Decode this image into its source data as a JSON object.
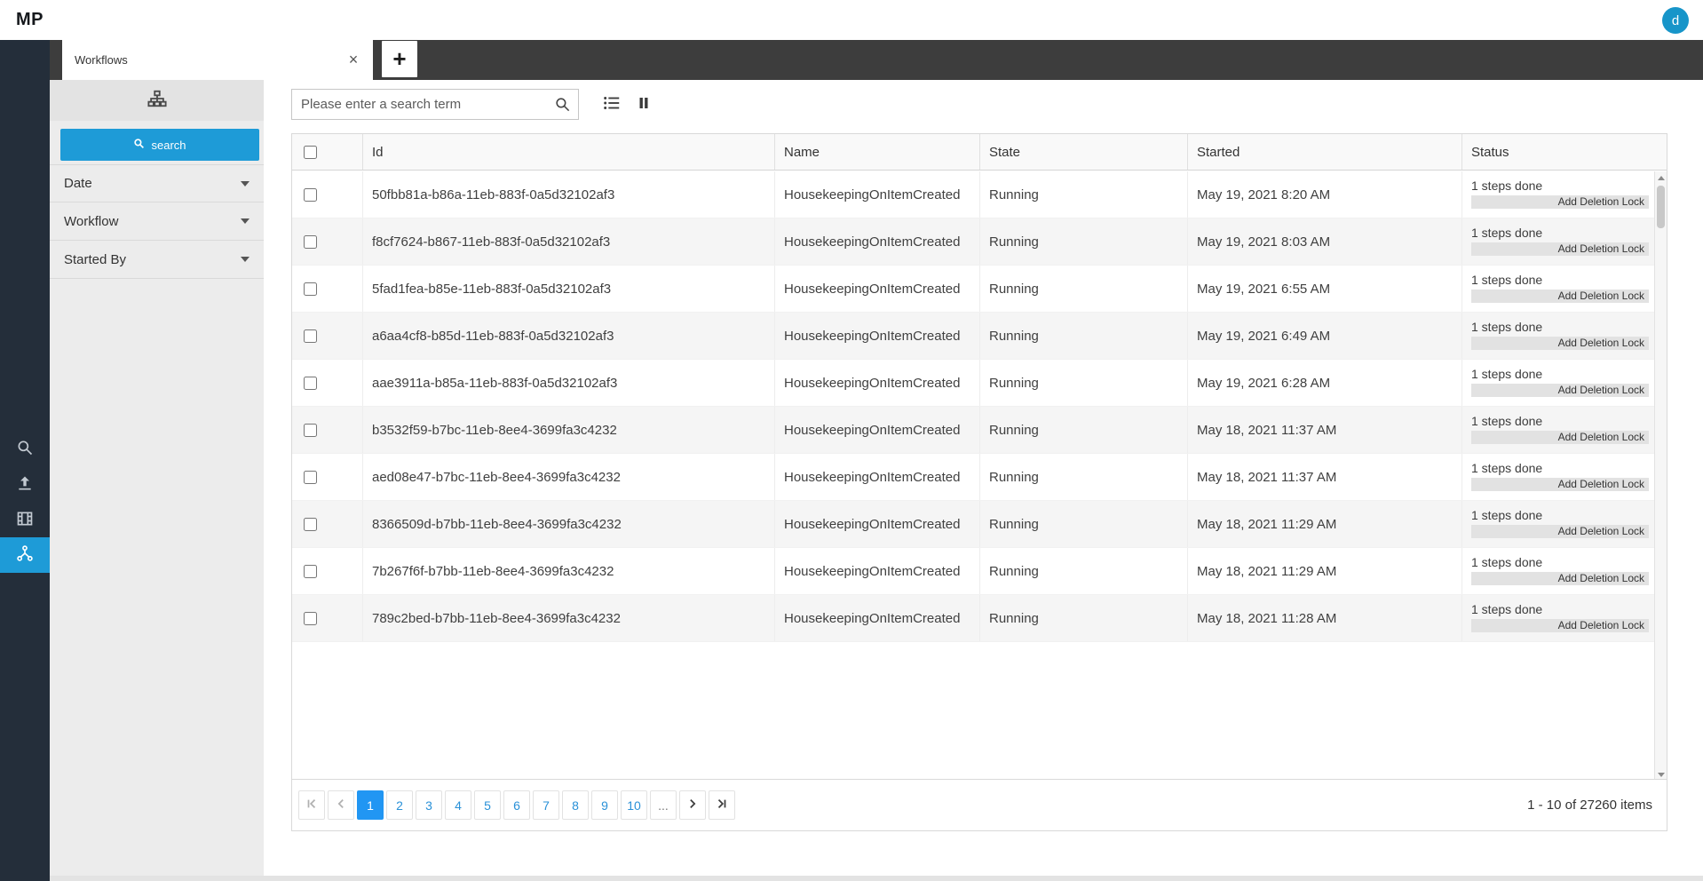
{
  "header": {
    "logo": "MP",
    "avatar_initial": "d"
  },
  "tab_bar": {
    "active_tab": "Workflows",
    "close_glyph": "×",
    "add_glyph": "+"
  },
  "rail": {
    "items": [
      "search",
      "upload",
      "media",
      "workflows"
    ],
    "active_item": "workflows"
  },
  "filter_panel": {
    "search_button_label": "search",
    "sections": [
      "Date",
      "Workflow",
      "Started By"
    ]
  },
  "toolbar": {
    "search_placeholder": "Please enter a search term"
  },
  "grid": {
    "columns": {
      "id": "Id",
      "name": "Name",
      "state": "State",
      "started": "Started",
      "status": "Status"
    },
    "rows": [
      {
        "id": "50fbb81a-b86a-11eb-883f-0a5d32102af3",
        "name": "HousekeepingOnItemCreated",
        "state": "Running",
        "started": "May 19, 2021 8:20 AM",
        "status_text": "1 steps done",
        "status_action": "Add Deletion Lock"
      },
      {
        "id": "f8cf7624-b867-11eb-883f-0a5d32102af3",
        "name": "HousekeepingOnItemCreated",
        "state": "Running",
        "started": "May 19, 2021 8:03 AM",
        "status_text": "1 steps done",
        "status_action": "Add Deletion Lock"
      },
      {
        "id": "5fad1fea-b85e-11eb-883f-0a5d32102af3",
        "name": "HousekeepingOnItemCreated",
        "state": "Running",
        "started": "May 19, 2021 6:55 AM",
        "status_text": "1 steps done",
        "status_action": "Add Deletion Lock"
      },
      {
        "id": "a6aa4cf8-b85d-11eb-883f-0a5d32102af3",
        "name": "HousekeepingOnItemCreated",
        "state": "Running",
        "started": "May 19, 2021 6:49 AM",
        "status_text": "1 steps done",
        "status_action": "Add Deletion Lock"
      },
      {
        "id": "aae3911a-b85a-11eb-883f-0a5d32102af3",
        "name": "HousekeepingOnItemCreated",
        "state": "Running",
        "started": "May 19, 2021 6:28 AM",
        "status_text": "1 steps done",
        "status_action": "Add Deletion Lock"
      },
      {
        "id": "b3532f59-b7bc-11eb-8ee4-3699fa3c4232",
        "name": "HousekeepingOnItemCreated",
        "state": "Running",
        "started": "May 18, 2021 11:37 AM",
        "status_text": "1 steps done",
        "status_action": "Add Deletion Lock"
      },
      {
        "id": "aed08e47-b7bc-11eb-8ee4-3699fa3c4232",
        "name": "HousekeepingOnItemCreated",
        "state": "Running",
        "started": "May 18, 2021 11:37 AM",
        "status_text": "1 steps done",
        "status_action": "Add Deletion Lock"
      },
      {
        "id": "8366509d-b7bb-11eb-8ee4-3699fa3c4232",
        "name": "HousekeepingOnItemCreated",
        "state": "Running",
        "started": "May 18, 2021 11:29 AM",
        "status_text": "1 steps done",
        "status_action": "Add Deletion Lock"
      },
      {
        "id": "7b267f6f-b7bb-11eb-8ee4-3699fa3c4232",
        "name": "HousekeepingOnItemCreated",
        "state": "Running",
        "started": "May 18, 2021 11:29 AM",
        "status_text": "1 steps done",
        "status_action": "Add Deletion Lock"
      },
      {
        "id": "789c2bed-b7bb-11eb-8ee4-3699fa3c4232",
        "name": "HousekeepingOnItemCreated",
        "state": "Running",
        "started": "May 18, 2021 11:28 AM",
        "status_text": "1 steps done",
        "status_action": "Add Deletion Lock"
      }
    ]
  },
  "pager": {
    "pages": [
      "1",
      "2",
      "3",
      "4",
      "5",
      "6",
      "7",
      "8",
      "9",
      "10"
    ],
    "active_page": "1",
    "ellipsis": "...",
    "info": "1 - 10 of 27260 items"
  },
  "colors": {
    "accent": "#1e9bd7",
    "pager_active": "#2196f3",
    "rail_bg": "#242e3a",
    "tabbar_bg": "#3d3d3d",
    "avatar": "#1795c9"
  }
}
